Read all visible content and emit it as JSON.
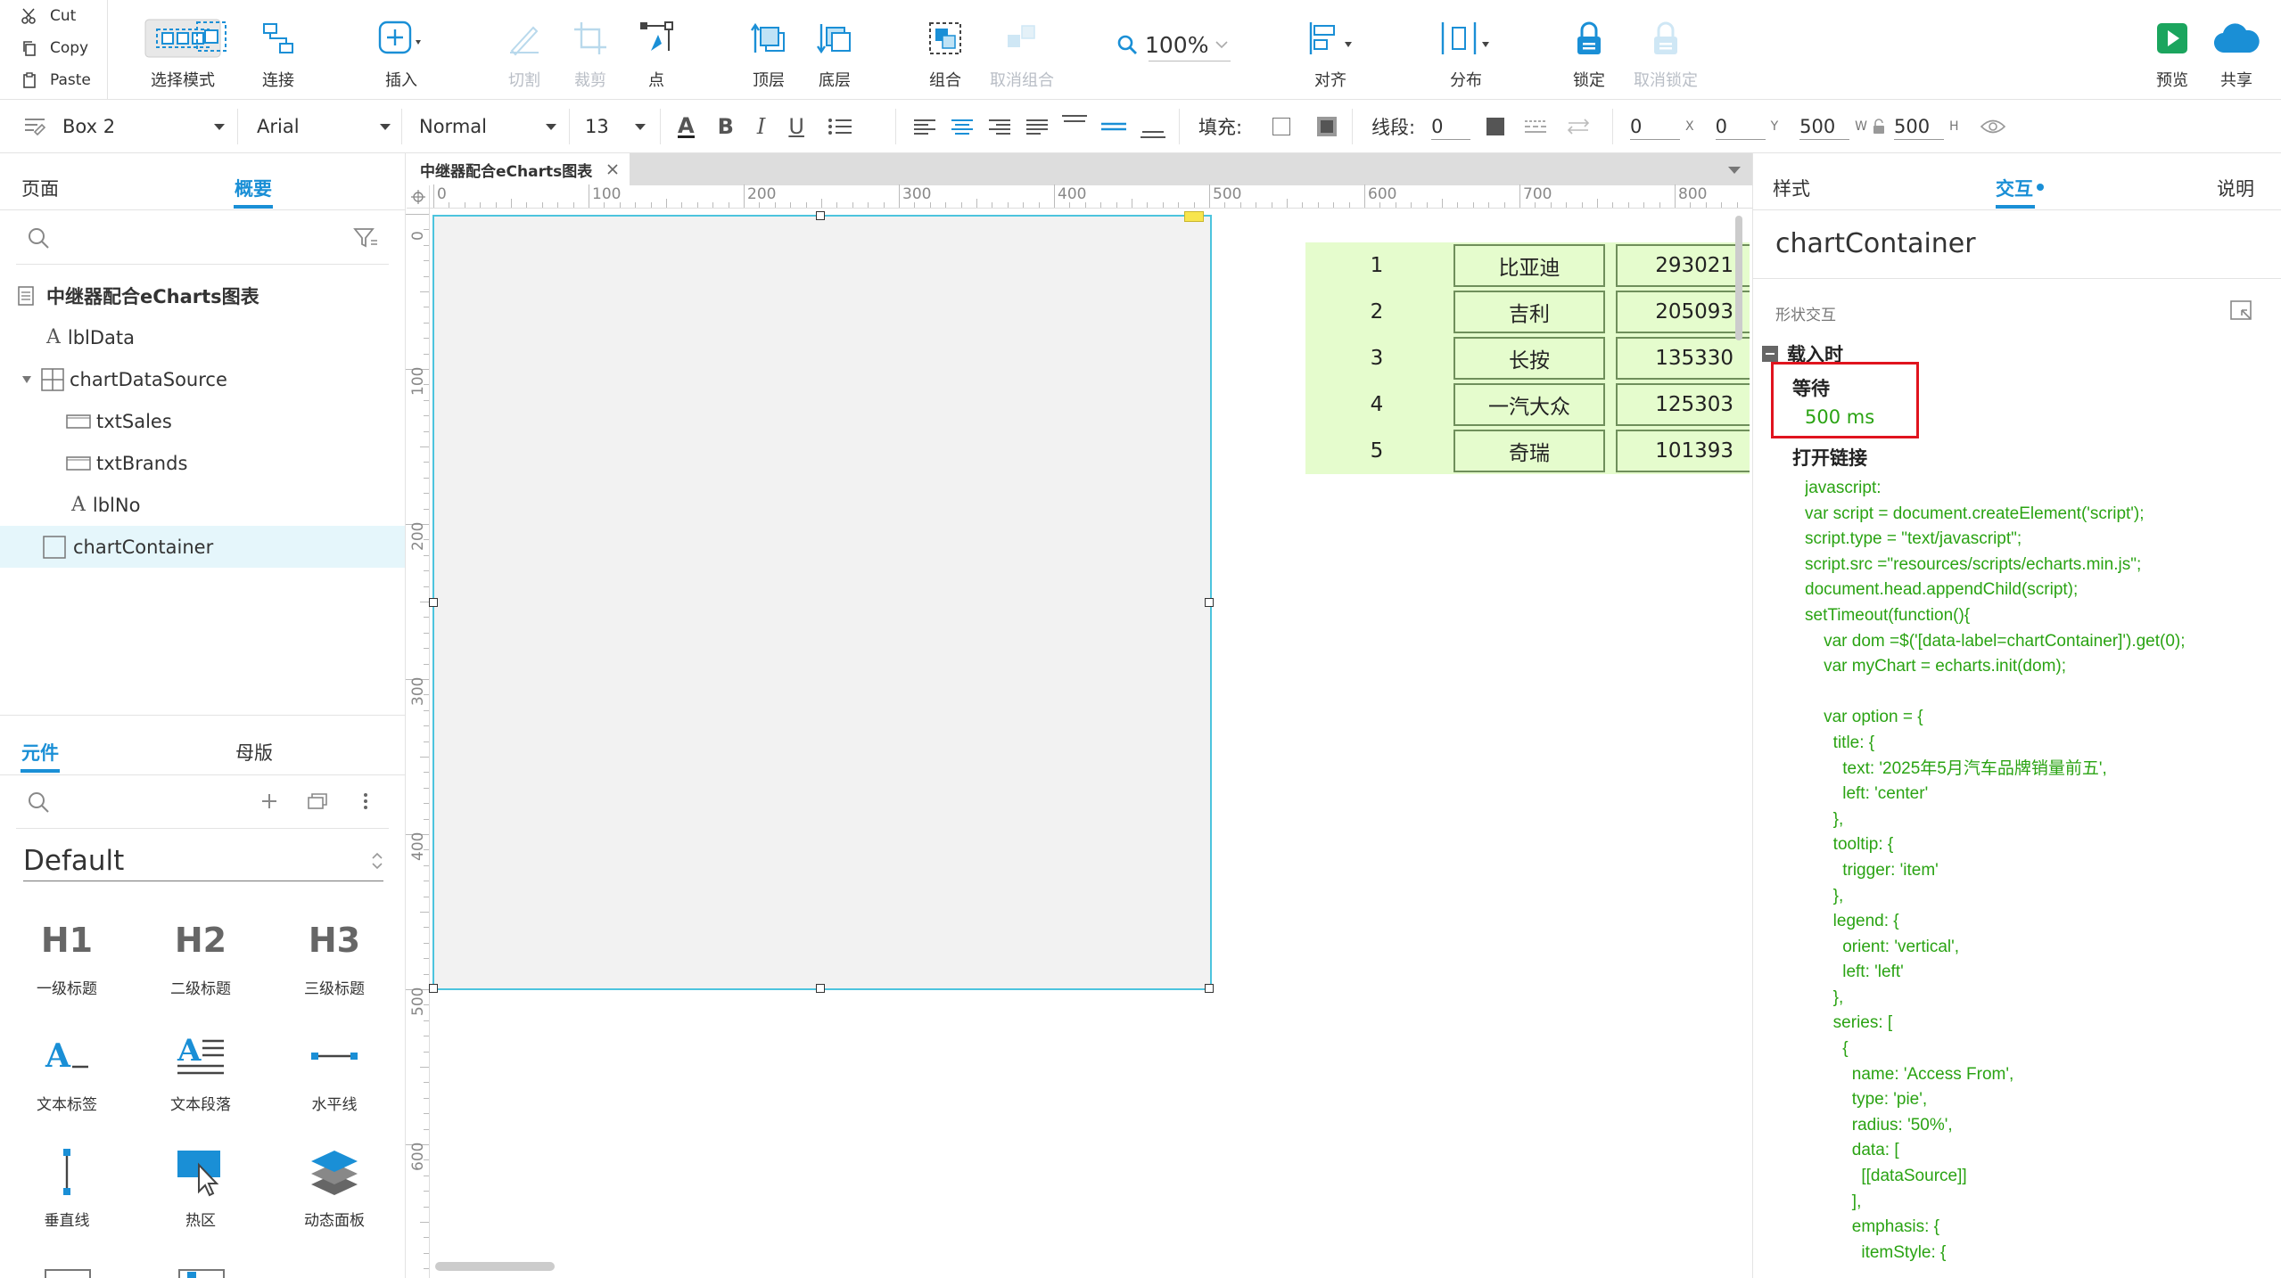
{
  "toolbar": {
    "clipboard": {
      "cut": "Cut",
      "copy": "Copy",
      "paste": "Paste"
    },
    "select_mode": "选择模式",
    "connect": "连接",
    "insert": "插入",
    "cut_shape": "切割",
    "crop": "裁剪",
    "point": "点",
    "bring_front": "顶层",
    "send_back": "底层",
    "group": "组合",
    "ungroup": "取消组合",
    "zoom": "100%",
    "align": "对齐",
    "distribute": "分布",
    "lock": "锁定",
    "unlock": "取消锁定",
    "preview": "预览",
    "share": "共享"
  },
  "formatbar": {
    "style_name": "Box 2",
    "font_family": "Arial",
    "font_weight": "Normal",
    "font_size": "13",
    "fill_label": "填充:",
    "stroke_label": "线段:",
    "stroke_value": "0",
    "x": "0",
    "x_unit": "X",
    "y": "0",
    "y_unit": "Y",
    "w": "500",
    "w_unit": "W",
    "h": "500",
    "h_unit": "H"
  },
  "left_panel": {
    "tabs": {
      "pages": "页面",
      "outline": "概要"
    },
    "outline": [
      {
        "label": "中继器配合eCharts图表",
        "type": "page"
      },
      {
        "label": "lblData",
        "type": "text"
      },
      {
        "label": "chartDataSource",
        "type": "repeater"
      },
      {
        "label": "txtSales",
        "type": "input"
      },
      {
        "label": "txtBrands",
        "type": "input"
      },
      {
        "label": "lblNo",
        "type": "text"
      },
      {
        "label": "chartContainer",
        "type": "box"
      }
    ],
    "lib_tabs": {
      "widgets": "元件",
      "masters": "母版"
    },
    "library_name": "Default",
    "widgets": [
      {
        "icon": "H1",
        "label": "一级标题"
      },
      {
        "icon": "H2",
        "label": "二级标题"
      },
      {
        "icon": "H3",
        "label": "三级标题"
      },
      {
        "icon": "text-label-icon",
        "label": "文本标签"
      },
      {
        "icon": "text-paragraph-icon",
        "label": "文本段落"
      },
      {
        "icon": "horizontal-line-icon",
        "label": "水平线"
      },
      {
        "icon": "vertical-line-icon",
        "label": "垂直线"
      },
      {
        "icon": "hotspot-icon",
        "label": "热区"
      },
      {
        "icon": "dynamic-panel-icon",
        "label": "动态面板"
      }
    ]
  },
  "canvas": {
    "doc_tab": "中继器配合eCharts图表",
    "ruler_h": [
      "0",
      "100",
      "200",
      "300",
      "400",
      "500",
      "600",
      "700",
      "800"
    ],
    "ruler_v": [
      "0",
      "100",
      "200",
      "300",
      "400",
      "500",
      "600"
    ],
    "table": [
      {
        "no": "1",
        "brand": "比亚迪",
        "sales": "293021"
      },
      {
        "no": "2",
        "brand": "吉利",
        "sales": "205093"
      },
      {
        "no": "3",
        "brand": "长按",
        "sales": "135330"
      },
      {
        "no": "4",
        "brand": "一汽大众",
        "sales": "125303"
      },
      {
        "no": "5",
        "brand": "奇瑞",
        "sales": "101393"
      }
    ]
  },
  "right_panel": {
    "tabs": {
      "style": "样式",
      "interaction": "交互",
      "notes": "说明"
    },
    "element_name": "chartContainer",
    "section_label": "形状交互",
    "event": "载入时",
    "wait_title": "等待",
    "wait_value": "500 ms",
    "action_title": "打开链接",
    "code_lines": [
      "javascript:",
      "var script = document.createElement('script');",
      "script.type = \"text/javascript\";",
      "script.src =\"resources/scripts/echarts.min.js\";",
      "document.head.appendChild(script);",
      "setTimeout(function(){",
      "    var dom =$('[data-label=chartContainer]').get(0);",
      "    var myChart = echarts.init(dom);",
      "",
      "    var option = {",
      "      title: {",
      "        text: '2025年5月汽车品牌销量前五',",
      "        left: 'center'",
      "      },",
      "      tooltip: {",
      "        trigger: 'item'",
      "      },",
      "      legend: {",
      "        orient: 'vertical',",
      "        left: 'left'",
      "      },",
      "      series: [",
      "        {",
      "          name: 'Access From',",
      "          type: 'pie',",
      "          radius: '50%',",
      "          data: [",
      "            [[dataSource]]",
      "          ],",
      "          emphasis: {",
      "            itemStyle: {"
    ]
  },
  "colors": {
    "accent": "#1a8fd6",
    "selection": "#4cc4de",
    "code": "#2aa313",
    "highlight_box": "#e0141e",
    "table_bg": "#e5fccd"
  }
}
